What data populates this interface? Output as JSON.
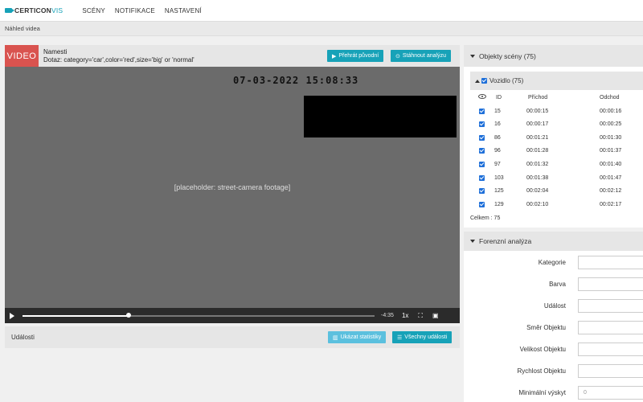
{
  "navbar": {
    "brand_part1": "CERTICON",
    "brand_part2": "VIS",
    "items": [
      "SCÉNY",
      "NOTIFIKACE",
      "NASTAVENÍ"
    ]
  },
  "breadcrumb": "Náhled videa",
  "video": {
    "badge": "VIDEO",
    "title": "Namesti",
    "query": "Dotaz: category='car',color='red',size='big' or 'normal'",
    "play_original_label": "Přehrát původní",
    "download_label": "Stáhnout analýzu",
    "overlay_timestamp": "07-03-2022 15:08:33",
    "placeholder_note": "[placeholder: street-camera footage]",
    "time_remaining": "-4:35",
    "speed": "1x"
  },
  "events": {
    "title": "Události",
    "show_stats_label": "Ukázat statistiky",
    "all_events_label": "Všechny události"
  },
  "scene_objects": {
    "header": "Objekty scény (75)",
    "group_label": "Vozidlo (75)",
    "columns": {
      "id": "ID",
      "arrival": "Příchod",
      "departure": "Odchod"
    },
    "rows": [
      {
        "id": "15",
        "arrival": "00:00:15",
        "departure": "00:00:16"
      },
      {
        "id": "16",
        "arrival": "00:00:17",
        "departure": "00:00:25"
      },
      {
        "id": "86",
        "arrival": "00:01:21",
        "departure": "00:01:30"
      },
      {
        "id": "96",
        "arrival": "00:01:28",
        "departure": "00:01:37"
      },
      {
        "id": "97",
        "arrival": "00:01:32",
        "departure": "00:01:40"
      },
      {
        "id": "103",
        "arrival": "00:01:38",
        "departure": "00:01:47"
      },
      {
        "id": "125",
        "arrival": "00:02:04",
        "departure": "00:02:12"
      },
      {
        "id": "129",
        "arrival": "00:02:10",
        "departure": "00:02:17"
      }
    ],
    "total": "Celkem : 75"
  },
  "forensic": {
    "header": "Forenzní analýza",
    "fields": [
      {
        "label": "Kategorie",
        "value": ""
      },
      {
        "label": "Barva",
        "value": ""
      },
      {
        "label": "Událost",
        "value": ""
      },
      {
        "label": "Směr Objektu",
        "value": ""
      },
      {
        "label": "Velikost Objektu",
        "value": ""
      },
      {
        "label": "Rychlost Objektu",
        "value": ""
      },
      {
        "label": "Minimální výskyt",
        "value": "0"
      }
    ]
  }
}
